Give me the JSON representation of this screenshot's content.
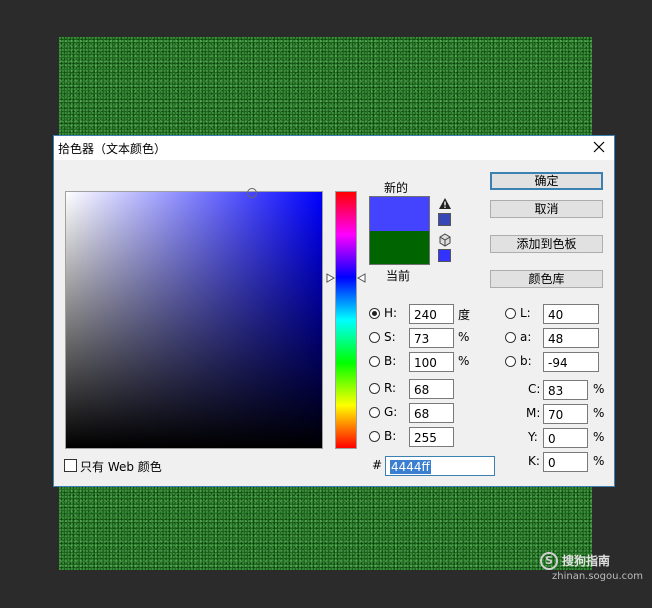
{
  "dialog": {
    "title": "拾色器（文本颜色）"
  },
  "preview": {
    "new_label": "新的",
    "current_label": "当前",
    "new_color": "#4444ff",
    "current_color": "#006400",
    "selected_hue_color": "#0000ff"
  },
  "buttons": {
    "ok": "确定",
    "cancel": "取消",
    "add_to_swatches": "添加到色板",
    "color_libraries": "颜色库"
  },
  "hsb": {
    "h_label": "H:",
    "h_value": "240",
    "h_unit": "度",
    "s_label": "S:",
    "s_value": "73",
    "s_unit": "%",
    "b_label": "B:",
    "b_value": "100",
    "b_unit": "%"
  },
  "rgb": {
    "r_label": "R:",
    "r_value": "68",
    "g_label": "G:",
    "g_value": "68",
    "b_label": "B:",
    "b_value": "255"
  },
  "lab": {
    "l_label": "L:",
    "l_value": "40",
    "a_label": "a:",
    "a_value": "48",
    "b_label": "b:",
    "b_value": "-94"
  },
  "cmyk": {
    "c_label": "C:",
    "c_value": "83",
    "c_unit": "%",
    "m_label": "M:",
    "m_value": "70",
    "m_unit": "%",
    "y_label": "Y:",
    "y_value": "0",
    "y_unit": "%",
    "k_label": "K:",
    "k_value": "0",
    "k_unit": "%"
  },
  "hex": {
    "label": "#",
    "value": "4444ff"
  },
  "web_only": {
    "label": "只有 Web 颜色",
    "checked": false
  },
  "watermark": {
    "name": "搜狗指南",
    "url": "zhinan.sogou.com",
    "logo_letter": "S"
  },
  "icons": {
    "close": "close-icon",
    "gamut_warning": "warning-triangle-icon",
    "web_safe": "cube-icon"
  }
}
